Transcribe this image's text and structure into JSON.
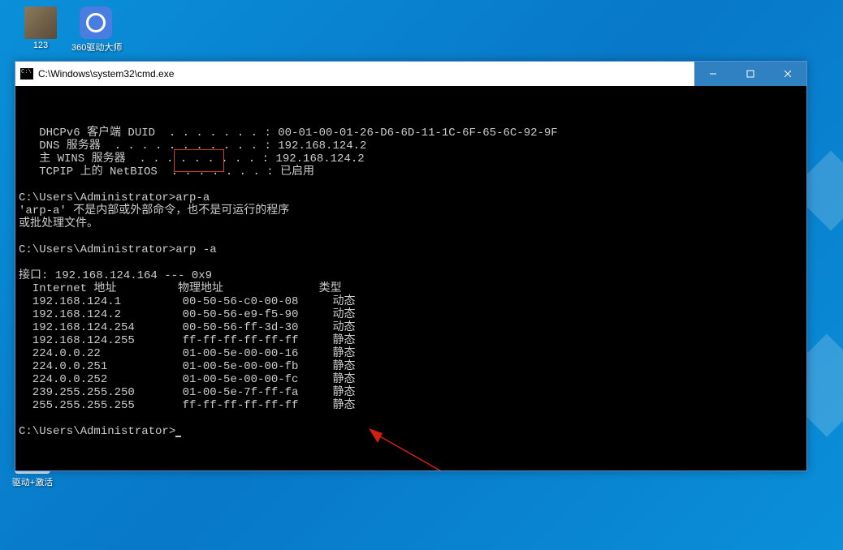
{
  "desktop": {
    "icons": [
      {
        "name": "icon-123",
        "label": "123"
      },
      {
        "name": "icon-360",
        "label": "360驱动大师"
      },
      {
        "name": "icon-driver",
        "label": "驱动+激活"
      }
    ]
  },
  "window": {
    "title": "C:\\Windows\\system32\\cmd.exe"
  },
  "terminal": {
    "lines": [
      "   DHCPv6 客户端 DUID  . . . . . . . : 00-01-00-01-26-D6-6D-11-1C-6F-65-6C-92-9F",
      "   DNS 服务器  . . . . . . . . . . . : 192.168.124.2",
      "   主 WINS 服务器  . . . . . . . . . : 192.168.124.2",
      "   TCPIP 上的 NetBIOS  . . . . . . . : 已启用",
      "",
      "C:\\Users\\Administrator>arp-a",
      "'arp-a' 不是内部或外部命令，也不是可运行的程序",
      "或批处理文件。",
      "",
      "C:\\Users\\Administrator>arp -a",
      "",
      "接口: 192.168.124.164 --- 0x9",
      "  Internet 地址         物理地址              类型",
      "  192.168.124.1         00-50-56-c0-00-08     动态",
      "  192.168.124.2         00-50-56-e9-f5-90     动态",
      "  192.168.124.254       00-50-56-ff-3d-30     动态",
      "  192.168.124.255       ff-ff-ff-ff-ff-ff     静态",
      "  224.0.0.22            01-00-5e-00-00-16     静态",
      "  224.0.0.251           01-00-5e-00-00-fb     静态",
      "  224.0.0.252           01-00-5e-00-00-fc     静态",
      "  239.255.255.250       01-00-5e-7f-ff-fa     静态",
      "  255.255.255.255       ff-ff-ff-ff-ff-ff     静态",
      "",
      "C:\\Users\\Administrator>"
    ],
    "prompt_final": "C:\\Users\\Administrator>"
  },
  "annotation": {
    "highlight_command": "arp-a"
  }
}
